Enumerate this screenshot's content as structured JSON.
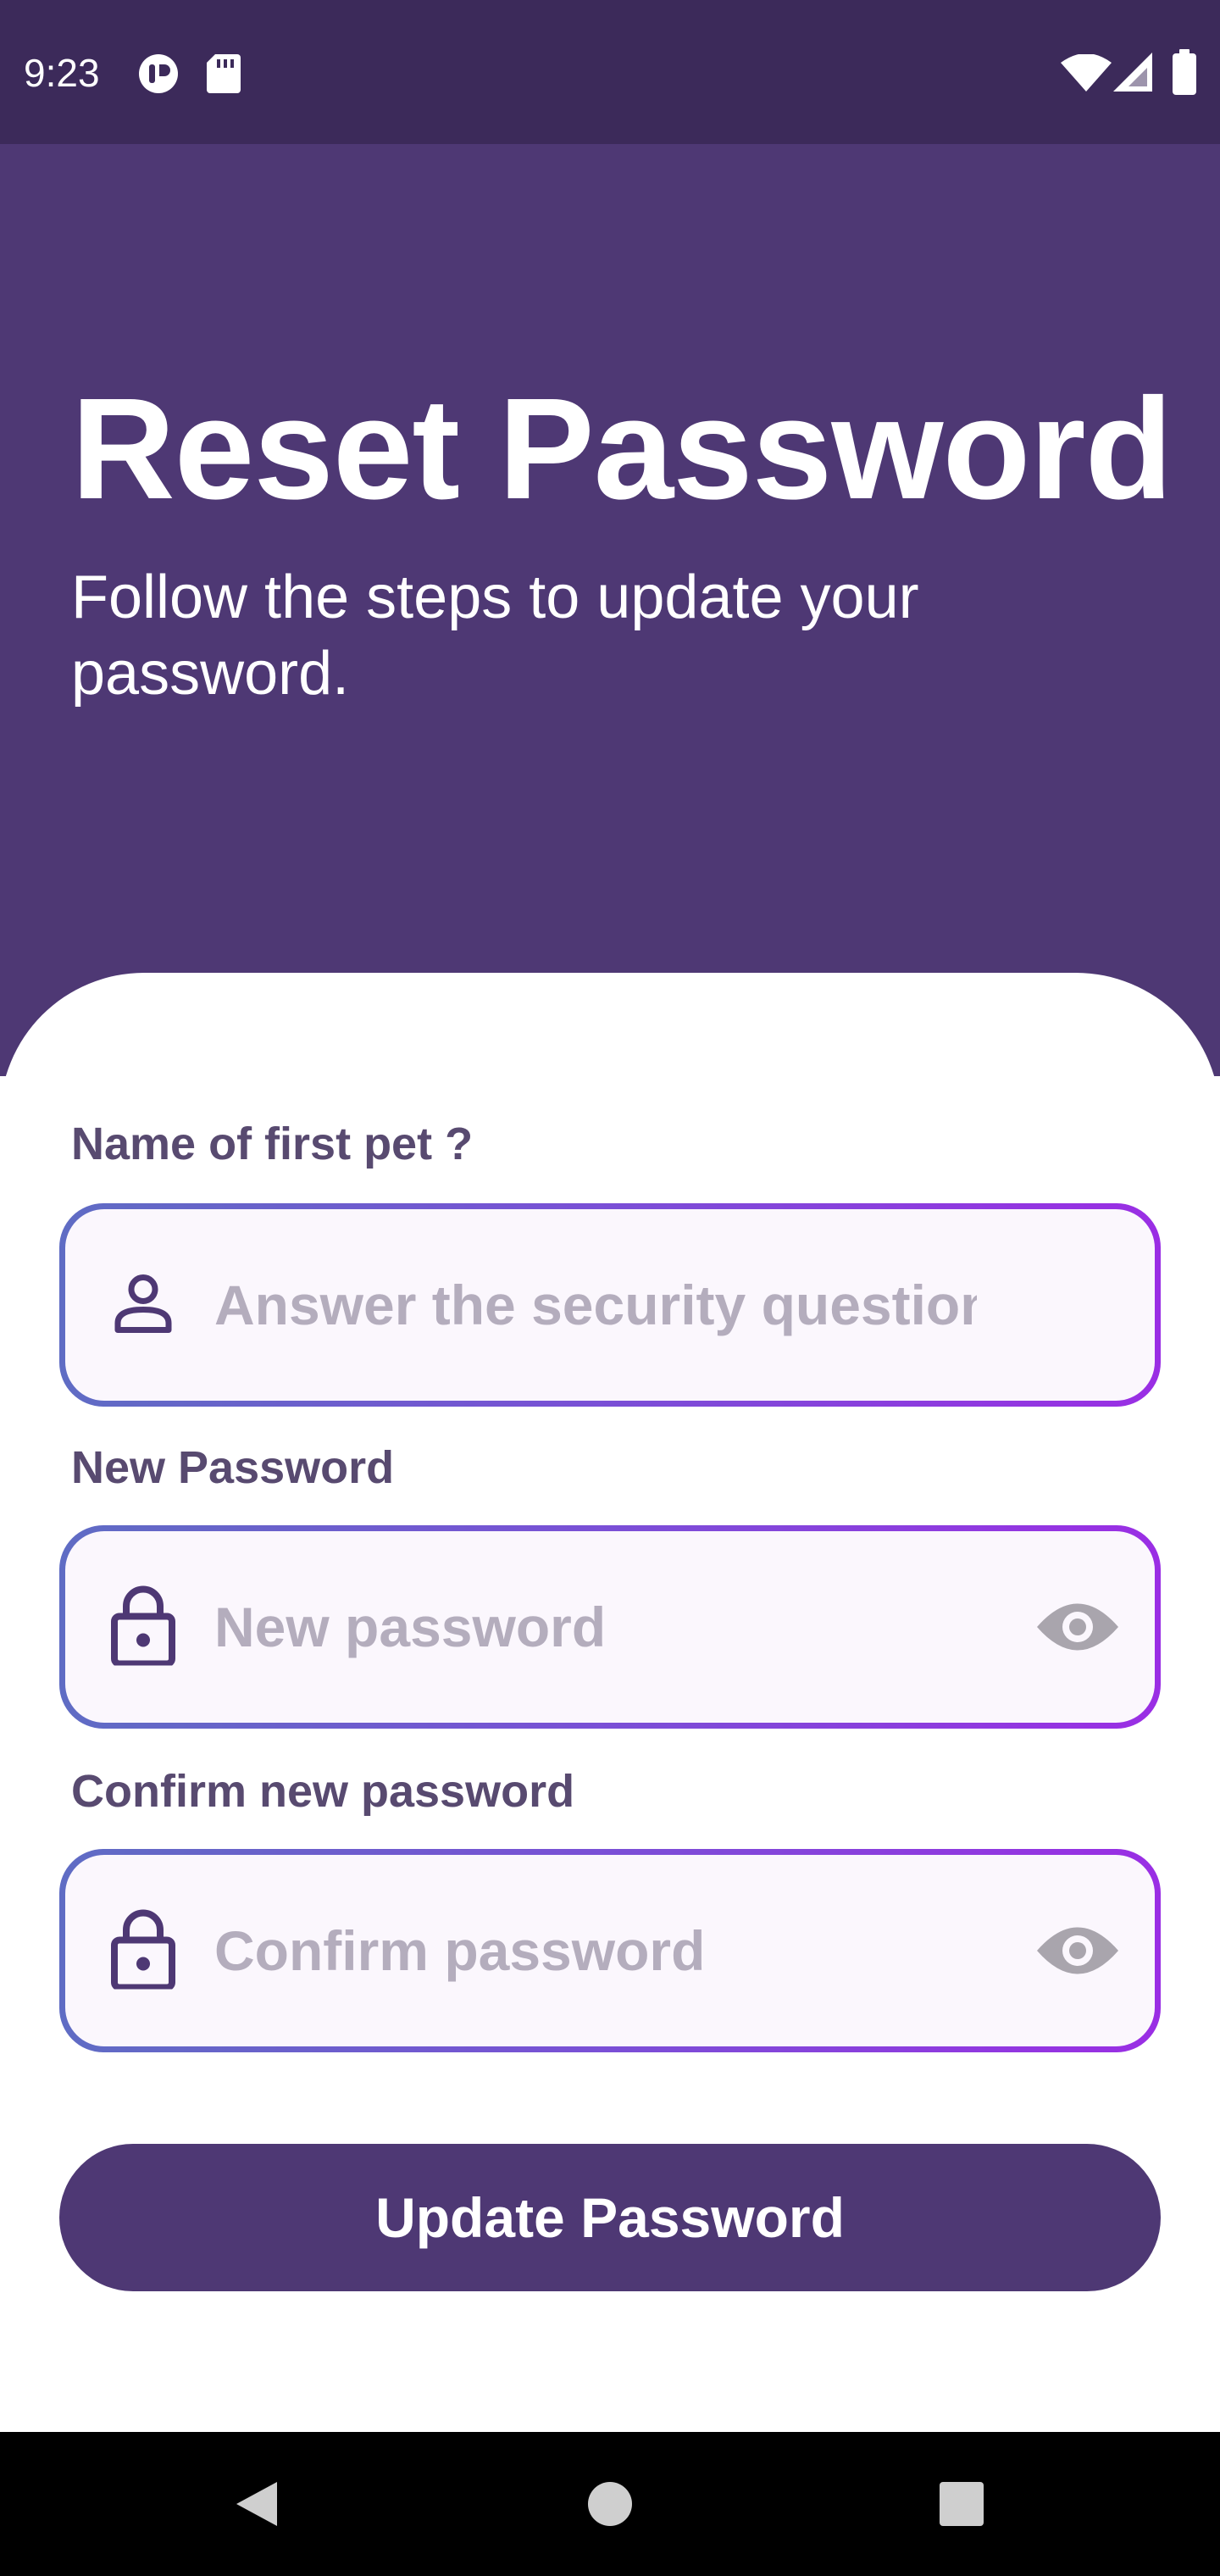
{
  "status_bar": {
    "time": "9:23",
    "left_icons": [
      "data-saver-icon",
      "sd-card-icon"
    ],
    "right_icons": [
      "wifi-icon",
      "cellular-signal-icon",
      "battery-icon"
    ]
  },
  "header": {
    "title": "Reset Password",
    "subtitle": "Follow the steps to update your password."
  },
  "form": {
    "security_question": {
      "label": "Name of first pet ?",
      "placeholder": "Answer the security question",
      "value": "",
      "icon": "person-icon"
    },
    "new_password": {
      "label": "New Password",
      "placeholder": "New password",
      "value": "",
      "icon": "lock-icon",
      "toggle_icon": "eye-icon"
    },
    "confirm_password": {
      "label": "Confirm new password",
      "placeholder": "Confirm password",
      "value": "",
      "icon": "lock-icon",
      "toggle_icon": "eye-icon"
    },
    "submit_label": "Update Password"
  },
  "nav_bar": {
    "buttons": [
      "back-icon",
      "home-icon",
      "recents-icon"
    ]
  },
  "colors": {
    "primary": "#4e3874",
    "status_bar": "#3c2a5a",
    "field_border_start": "#5f6cc4",
    "field_border_end": "#9a2ee4",
    "label": "#584a70",
    "placeholder": "#b4adbd",
    "eye_icon": "#a9a5ad"
  }
}
